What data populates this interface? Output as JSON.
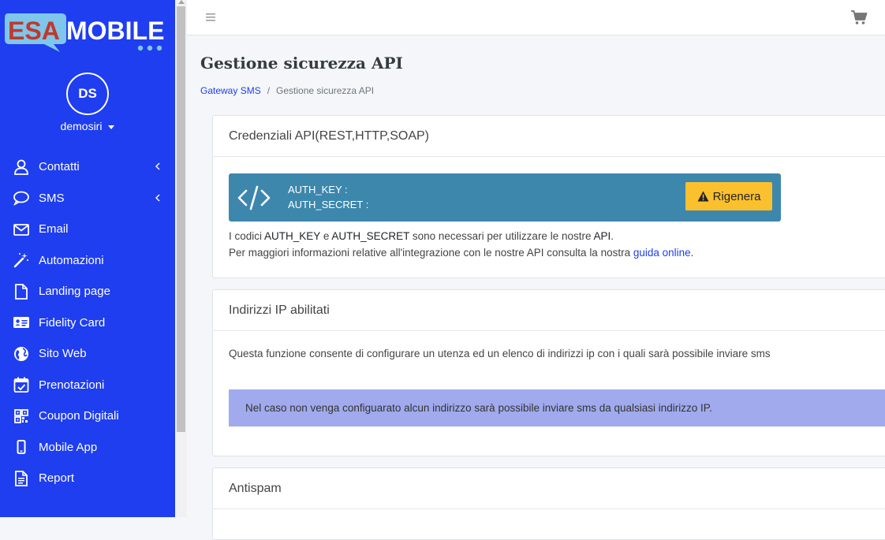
{
  "brand": {
    "logo_esa": "ESA",
    "logo_mobile": "MOBILE"
  },
  "user": {
    "initials": "DS",
    "name": "demosiri"
  },
  "colors": {
    "sidebar": "#1f3ef0",
    "keybox": "#3d87ad",
    "regenerate_button": "#fbc02d",
    "notice": "#a0aaed",
    "link": "#1f3ef0"
  },
  "sidebar": {
    "items": [
      {
        "label": "Contatti",
        "icon": "user-icon",
        "has_submenu": true
      },
      {
        "label": "SMS",
        "icon": "chat-bubble-icon",
        "has_submenu": true
      },
      {
        "label": "Email",
        "icon": "envelope-icon",
        "has_submenu": false
      },
      {
        "label": "Automazioni",
        "icon": "magic-wand-icon",
        "has_submenu": false
      },
      {
        "label": "Landing page",
        "icon": "file-icon",
        "has_submenu": false
      },
      {
        "label": "Fidelity Card",
        "icon": "id-card-icon",
        "has_submenu": false
      },
      {
        "label": "Sito Web",
        "icon": "globe-icon",
        "has_submenu": false
      },
      {
        "label": "Prenotazioni",
        "icon": "calendar-check-icon",
        "has_submenu": false
      },
      {
        "label": "Coupon Digitali",
        "icon": "qrcode-icon",
        "has_submenu": false
      },
      {
        "label": "Mobile App",
        "icon": "mobile-icon",
        "has_submenu": false
      },
      {
        "label": "Report",
        "icon": "report-icon",
        "has_submenu": false
      }
    ]
  },
  "topbar": {
    "menu_icon": "hamburger-icon",
    "cart_icon": "cart-icon"
  },
  "page": {
    "title": "Gestione sicurezza API",
    "breadcrumb": {
      "parent": "Gateway SMS",
      "separator": "/",
      "current": "Gestione sicurezza API"
    }
  },
  "api_credentials": {
    "title": "Credenziali API(REST,HTTP,SOAP)",
    "auth_key_label": "AUTH_KEY :",
    "auth_secret_label": "AUTH_SECRET :",
    "regenerate_label": "Rigenera",
    "info": {
      "line1_prefix": "I codici ",
      "auth_key": "AUTH_KEY",
      "and": " e ",
      "auth_secret": "AUTH_SECRET",
      "line1_mid": " sono necessari per utilizzare le nostre ",
      "api": "API",
      "line1_end": ".",
      "line2_prefix": "Per maggiori informazioni relative all'integrazione con le nostre API consulta la nostra ",
      "guide_link": "guida online",
      "line2_end": "."
    }
  },
  "ip_section": {
    "title": "Indirizzi IP abilitati",
    "description": "Questa funzione consente di configurare un utenza ed un elenco di indirizzi ip con i quali sarà possibile inviare sms",
    "notice": "Nel caso non venga configuarato alcun indirizzo sarà possibile inviare sms da qualsiasi indirizzo IP."
  },
  "antispam": {
    "title": "Antispam"
  }
}
